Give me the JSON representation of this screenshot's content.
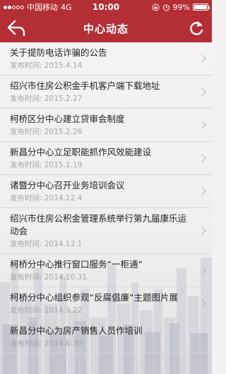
{
  "status_bar": {
    "carrier": "中国移动",
    "network": "4G",
    "time": "10:00",
    "battery": "99%",
    "battery_level": 0.99
  },
  "header": {
    "title": "中心动态",
    "back_icon": "back-arrow-icon",
    "refresh_icon": "refresh-icon",
    "accent_color": "#b42e36"
  },
  "list": {
    "date_prefix": "发布时间:",
    "items": [
      {
        "title": "关于提防电话诈骗的公告",
        "date": "发布时间:  2015.4.14"
      },
      {
        "title": "绍兴市住房公积金手机客户端下载地址",
        "date": "发布时间:  2015.2.27"
      },
      {
        "title": "柯桥区分中心建立贷审会制度",
        "date": "发布时间:  2015.2.26"
      },
      {
        "title": "新昌分中心立足职能抓作风效能建设",
        "date": "发布时间:  2015.1.19"
      },
      {
        "title": "诸暨分中心召开业务培训会议",
        "date": "发布时间:  2014.12.4"
      },
      {
        "title": "绍兴市住房公积金管理系统举行第九届康乐运动会",
        "date": "发布时间:  2014.12.1"
      },
      {
        "title": "柯桥分中心推行窗口服务“一柜通”",
        "date": "发布时间:  2014.10.31"
      },
      {
        "title": "柯桥分中心组织参观“反腐倡廉”主题图片展",
        "date": "发布时间:  2014.9.22"
      },
      {
        "title": "新昌分中心为房产销售人员作培训",
        "date": "发布时间:  2014.6.30"
      }
    ]
  }
}
